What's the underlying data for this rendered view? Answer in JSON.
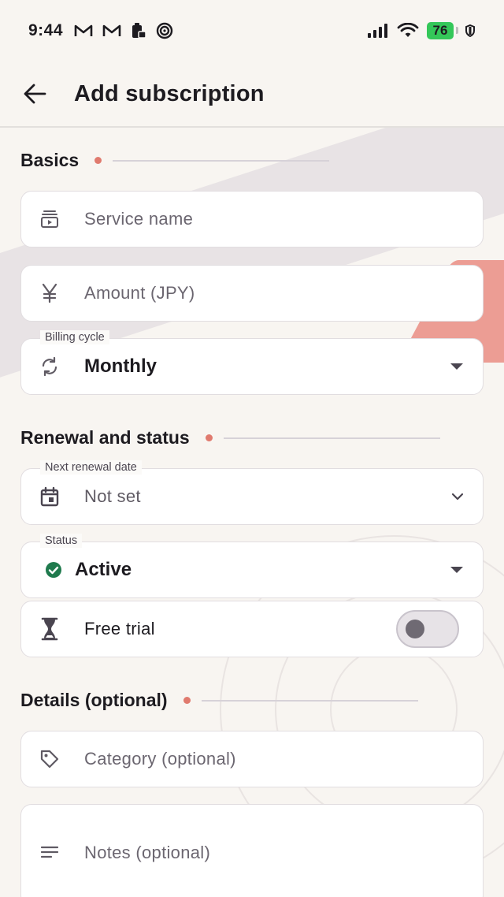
{
  "status_bar": {
    "time": "9:44",
    "battery": "76",
    "icons": [
      "gmail-icon",
      "gmail-icon",
      "clipboard-lock-icon",
      "target-icon",
      "signal-icon",
      "wifi-icon",
      "shield-icon"
    ]
  },
  "app_bar": {
    "title": "Add subscription",
    "back_icon": "arrow-left-icon"
  },
  "sections": {
    "basics": {
      "title": "Basics"
    },
    "renewal": {
      "title": "Renewal and status"
    },
    "details": {
      "title": "Details (optional)"
    }
  },
  "fields": {
    "service_name": {
      "placeholder": "Service name",
      "icon": "subscriptions-icon"
    },
    "amount": {
      "placeholder": "Amount (JPY)",
      "icon": "yen-icon"
    },
    "billing_cycle": {
      "label": "Billing cycle",
      "value": "Monthly",
      "icon": "sync-icon"
    },
    "next_renewal": {
      "label": "Next renewal date",
      "value": "Not set",
      "icon": "calendar-icon"
    },
    "status": {
      "label": "Status",
      "value": "Active",
      "icon": "check-circle-icon"
    },
    "free_trial": {
      "label": "Free trial",
      "icon": "hourglass-icon",
      "enabled": false
    },
    "category": {
      "placeholder": "Category (optional)",
      "icon": "tag-icon"
    },
    "notes": {
      "placeholder": "Notes (optional)",
      "icon": "notes-icon"
    }
  },
  "colors": {
    "accent_dot": "#e07a6e",
    "status_active": "#1f7a4d",
    "battery": "#34c759"
  }
}
